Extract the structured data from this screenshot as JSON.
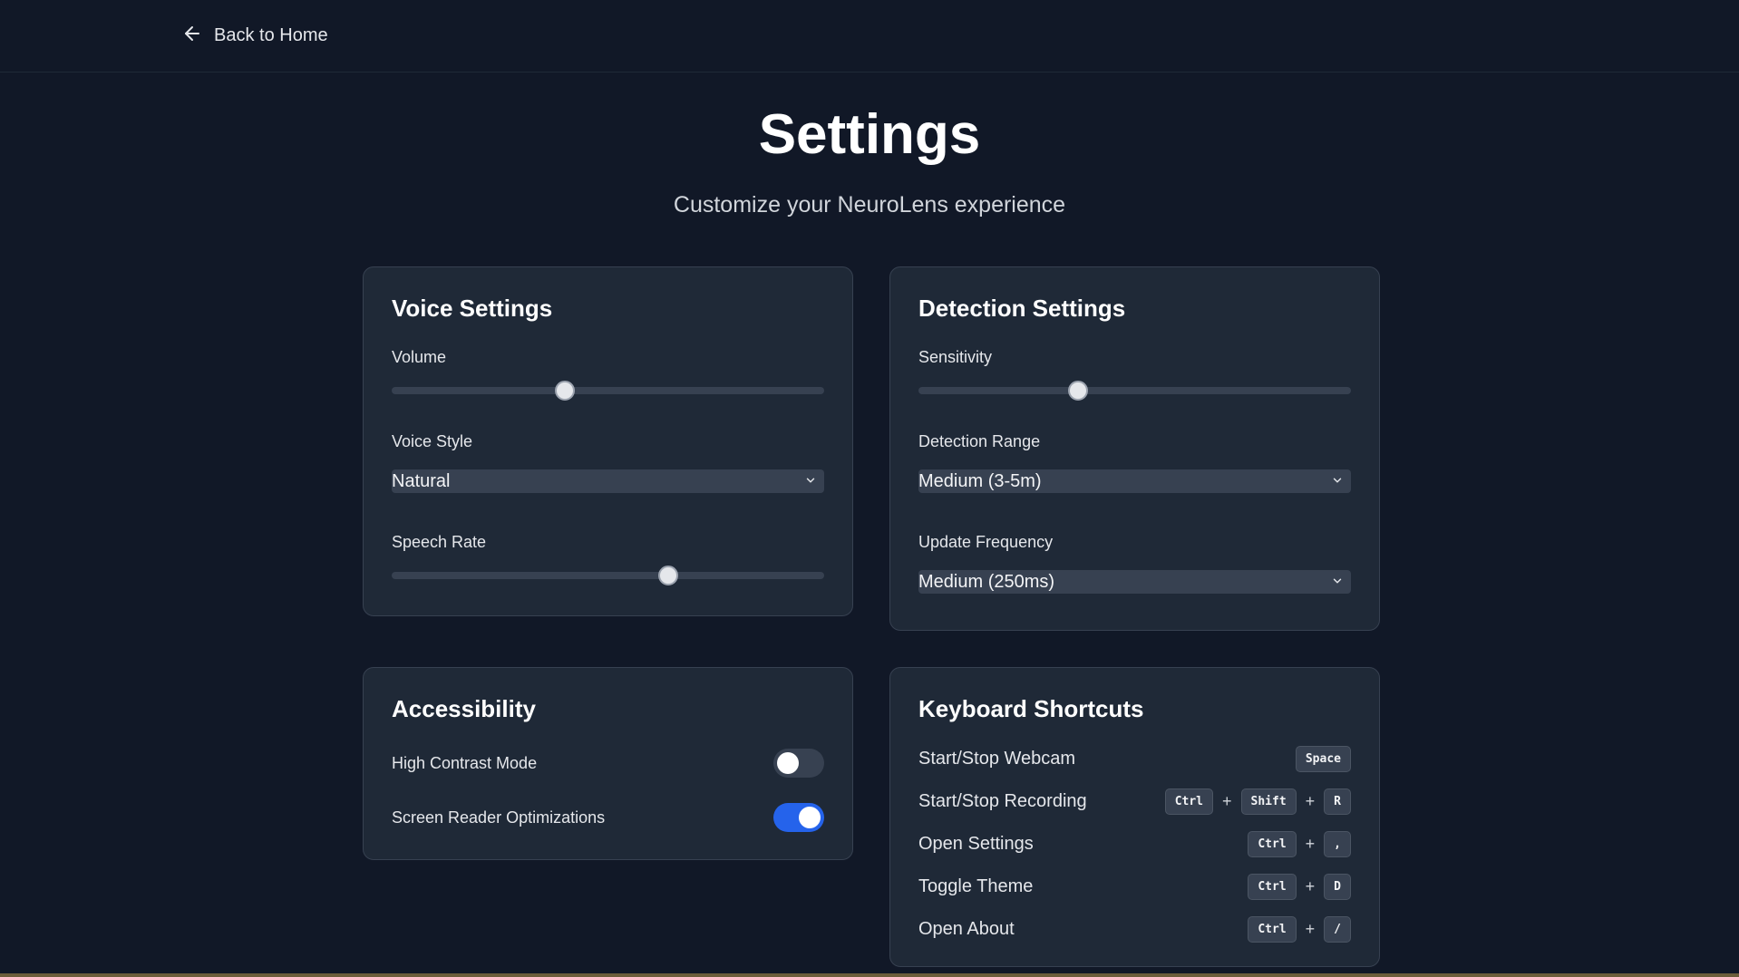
{
  "nav": {
    "back_label": "Back to Home"
  },
  "header": {
    "title": "Settings",
    "subtitle": "Customize your NeuroLens experience"
  },
  "voice": {
    "title": "Voice Settings",
    "volume_label": "Volume",
    "volume_value": 0.4,
    "style_label": "Voice Style",
    "style_value": "Natural",
    "rate_label": "Speech Rate",
    "rate_value": 0.64
  },
  "detection": {
    "title": "Detection Settings",
    "sensitivity_label": "Sensitivity",
    "sensitivity_value": 0.37,
    "range_label": "Detection Range",
    "range_value": "Medium (3-5m)",
    "frequency_label": "Update Frequency",
    "frequency_value": "Medium (250ms)"
  },
  "accessibility": {
    "title": "Accessibility",
    "items": [
      {
        "label": "High Contrast Mode",
        "on": false
      },
      {
        "label": "Screen Reader Optimizations",
        "on": true
      }
    ]
  },
  "shortcuts": {
    "title": "Keyboard Shortcuts",
    "plus": "+",
    "items": [
      {
        "label": "Start/Stop Webcam",
        "keys": [
          "Space"
        ]
      },
      {
        "label": "Start/Stop Recording",
        "keys": [
          "Ctrl",
          "Shift",
          "R"
        ]
      },
      {
        "label": "Open Settings",
        "keys": [
          "Ctrl",
          ","
        ]
      },
      {
        "label": "Toggle Theme",
        "keys": [
          "Ctrl",
          "D"
        ]
      },
      {
        "label": "Open About",
        "keys": [
          "Ctrl",
          "/"
        ]
      }
    ]
  },
  "colors": {
    "background": "#111827",
    "card": "#1f2937",
    "accent": "#2563eb"
  }
}
